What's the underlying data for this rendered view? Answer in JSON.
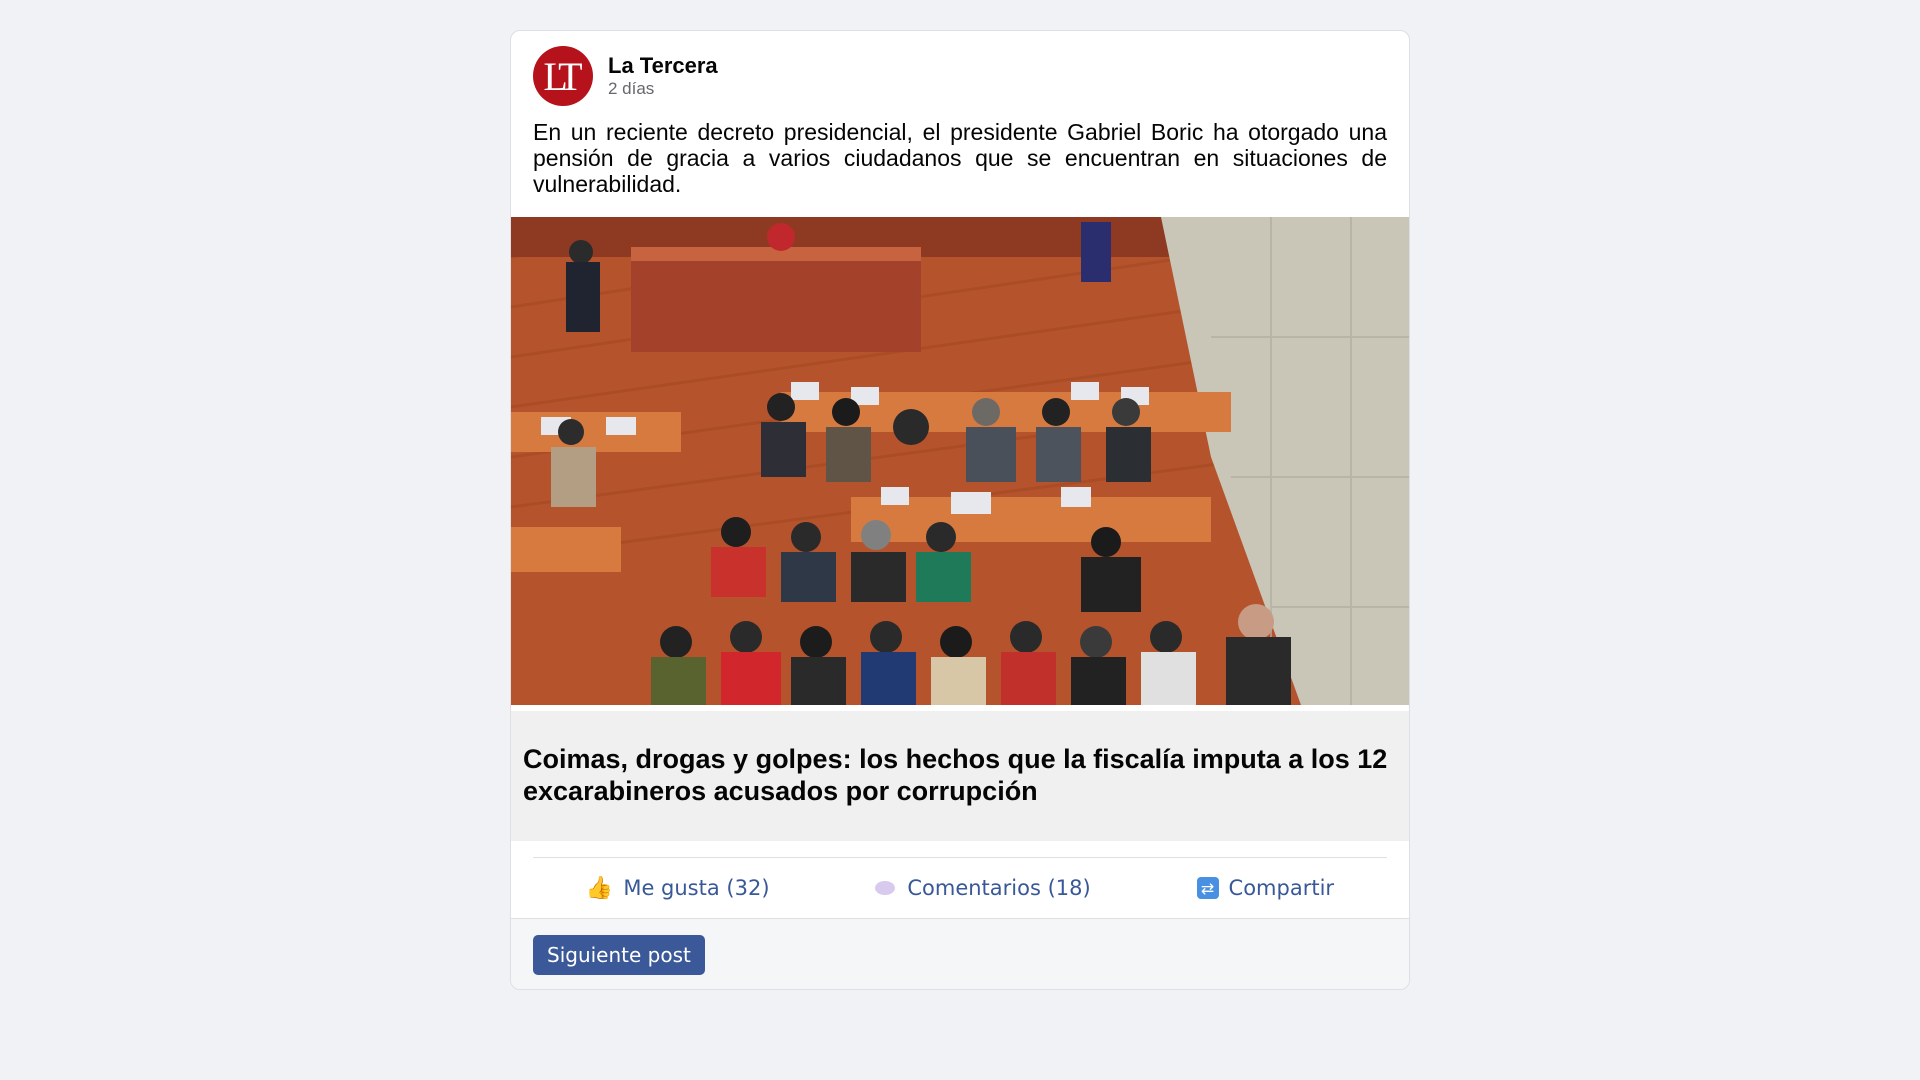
{
  "post": {
    "author": "La Tercera",
    "avatar_initials": "LT",
    "time": "2 días",
    "text": "En un reciente decreto presidencial, el presidente Gabriel Boric ha otorgado una pensión de gracia a varios ciudadanos que se encuentran en situaciones de vulnerabilidad.",
    "image_icon": "courtroom-photo",
    "link_title": "Coimas, drogas y golpes: los hechos que la fiscalía imputa a los 12 excarabineros acusados por corrupción"
  },
  "actions": {
    "like_label": "Me gusta (32)",
    "comment_label": "Comentarios (18)",
    "share_label": "Compartir"
  },
  "footer": {
    "next_label": "Siguiente post"
  },
  "colors": {
    "brand_red": "#b5121b",
    "action_blue": "#385898",
    "button_blue": "#3b5998",
    "background": "#f0f2f5"
  }
}
